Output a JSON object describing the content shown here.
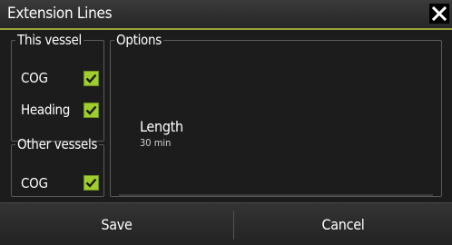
{
  "window": {
    "title": "Extension Lines",
    "close_icon": "close-icon"
  },
  "this_vessel": {
    "legend": "This vessel",
    "items": [
      {
        "label": "COG",
        "checked": true
      },
      {
        "label": "Heading",
        "checked": true
      }
    ]
  },
  "other_vessels": {
    "legend": "Other vessels",
    "items": [
      {
        "label": "COG",
        "checked": true
      }
    ]
  },
  "options": {
    "legend": "Options",
    "length_label": "Length",
    "length_value": "30 min"
  },
  "footer": {
    "save_label": "Save",
    "cancel_label": "Cancel"
  },
  "colors": {
    "accent": "#9aa335",
    "checkbox": "#9fce2f"
  }
}
